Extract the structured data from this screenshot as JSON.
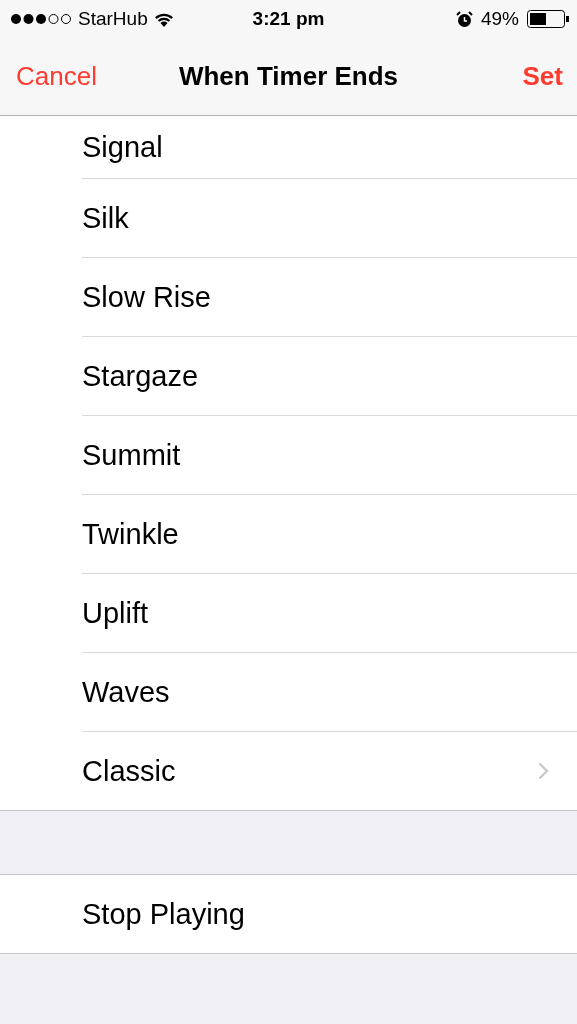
{
  "status_bar": {
    "carrier": "StarHub",
    "time": "3:21 pm",
    "battery": "49%"
  },
  "nav_bar": {
    "cancel": "Cancel",
    "title": "When Timer Ends",
    "set": "Set"
  },
  "tones": [
    {
      "label": "Signal",
      "kind": "tone"
    },
    {
      "label": "Silk",
      "kind": "tone"
    },
    {
      "label": "Slow Rise",
      "kind": "tone"
    },
    {
      "label": "Stargaze",
      "kind": "tone"
    },
    {
      "label": "Summit",
      "kind": "tone"
    },
    {
      "label": "Twinkle",
      "kind": "tone"
    },
    {
      "label": "Uplift",
      "kind": "tone"
    },
    {
      "label": "Waves",
      "kind": "tone"
    },
    {
      "label": "Classic",
      "kind": "submenu"
    }
  ],
  "stop_section": [
    {
      "label": "Stop Playing"
    }
  ]
}
